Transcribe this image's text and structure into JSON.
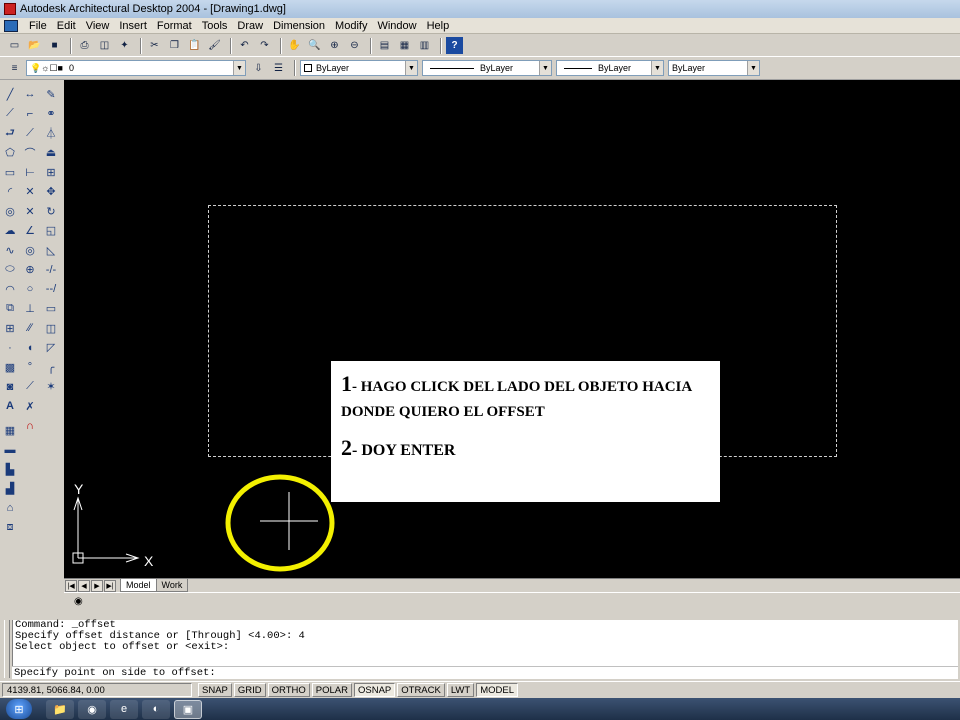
{
  "window": {
    "title": "Autodesk Architectural Desktop 2004 - [Drawing1.dwg]"
  },
  "menu": [
    "File",
    "Edit",
    "View",
    "Insert",
    "Format",
    "Tools",
    "Draw",
    "Dimension",
    "Modify",
    "Window",
    "Help"
  ],
  "properties": {
    "layer_value": "0",
    "color_value": "ByLayer",
    "linetype_value": "ByLayer",
    "lineweight_value": "ByLayer",
    "plotstyle_value": "ByLayer"
  },
  "annotation": {
    "step1_number": "1",
    "step1_text": "- HAGO CLICK DEL LADO DEL OBJETO HACIA DONDE QUIERO EL OFFSET",
    "step2_number": "2",
    "step2_text": "- DOY ENTER"
  },
  "ucs": {
    "x_label": "X",
    "y_label": "Y"
  },
  "tabs": {
    "model": "Model",
    "work": "Work"
  },
  "command": {
    "history": [
      "Command: _offset",
      "Specify offset distance or [Through] <4.00>: 4",
      "Select object to offset or <exit>:"
    ],
    "prompt": "Specify point on side to offset:"
  },
  "status": {
    "coords": "4139.81, 5066.84, 0.00",
    "snap": "SNAP",
    "grid": "GRID",
    "ortho": "ORTHO",
    "polar": "POLAR",
    "osnap": "OSNAP",
    "otrack": "OTRACK",
    "lwt": "LWT",
    "model": "MODEL"
  },
  "colors": {
    "highlight_circle": "#f3f000",
    "canvas": "#000000",
    "crosshair": "#ffffff"
  },
  "icons": {
    "toolbar": [
      "new-icon",
      "open-icon",
      "save-icon",
      "print-icon",
      "preview-icon",
      "publish-icon",
      "cut-icon",
      "copy-icon",
      "paste-icon",
      "match-icon",
      "undo-icon",
      "redo-icon",
      "pan-icon",
      "zoom-icon",
      "zoom-window-icon",
      "zoom-previous-icon",
      "properties-icon",
      "designcenter-icon",
      "toolpalettes-icon",
      "help-icon"
    ],
    "draw": [
      "line-icon",
      "xline-icon",
      "polyline-icon",
      "polygon-icon",
      "rectangle-icon",
      "arc-icon",
      "circle-icon",
      "revcloud-icon",
      "spline-icon",
      "ellipse-icon",
      "ellipse-arc-icon",
      "insert-block-icon",
      "make-block-icon",
      "point-icon",
      "hatch-icon",
      "region-icon",
      "mtext-icon"
    ],
    "modify": [
      "erase-icon",
      "copy-object-icon",
      "mirror-icon",
      "offset-icon",
      "array-icon",
      "move-icon",
      "rotate-icon",
      "scale-icon",
      "stretch-icon",
      "trim-icon",
      "extend-icon",
      "break-icon",
      "join-icon",
      "chamfer-icon",
      "fillet-icon",
      "explode-icon"
    ]
  }
}
